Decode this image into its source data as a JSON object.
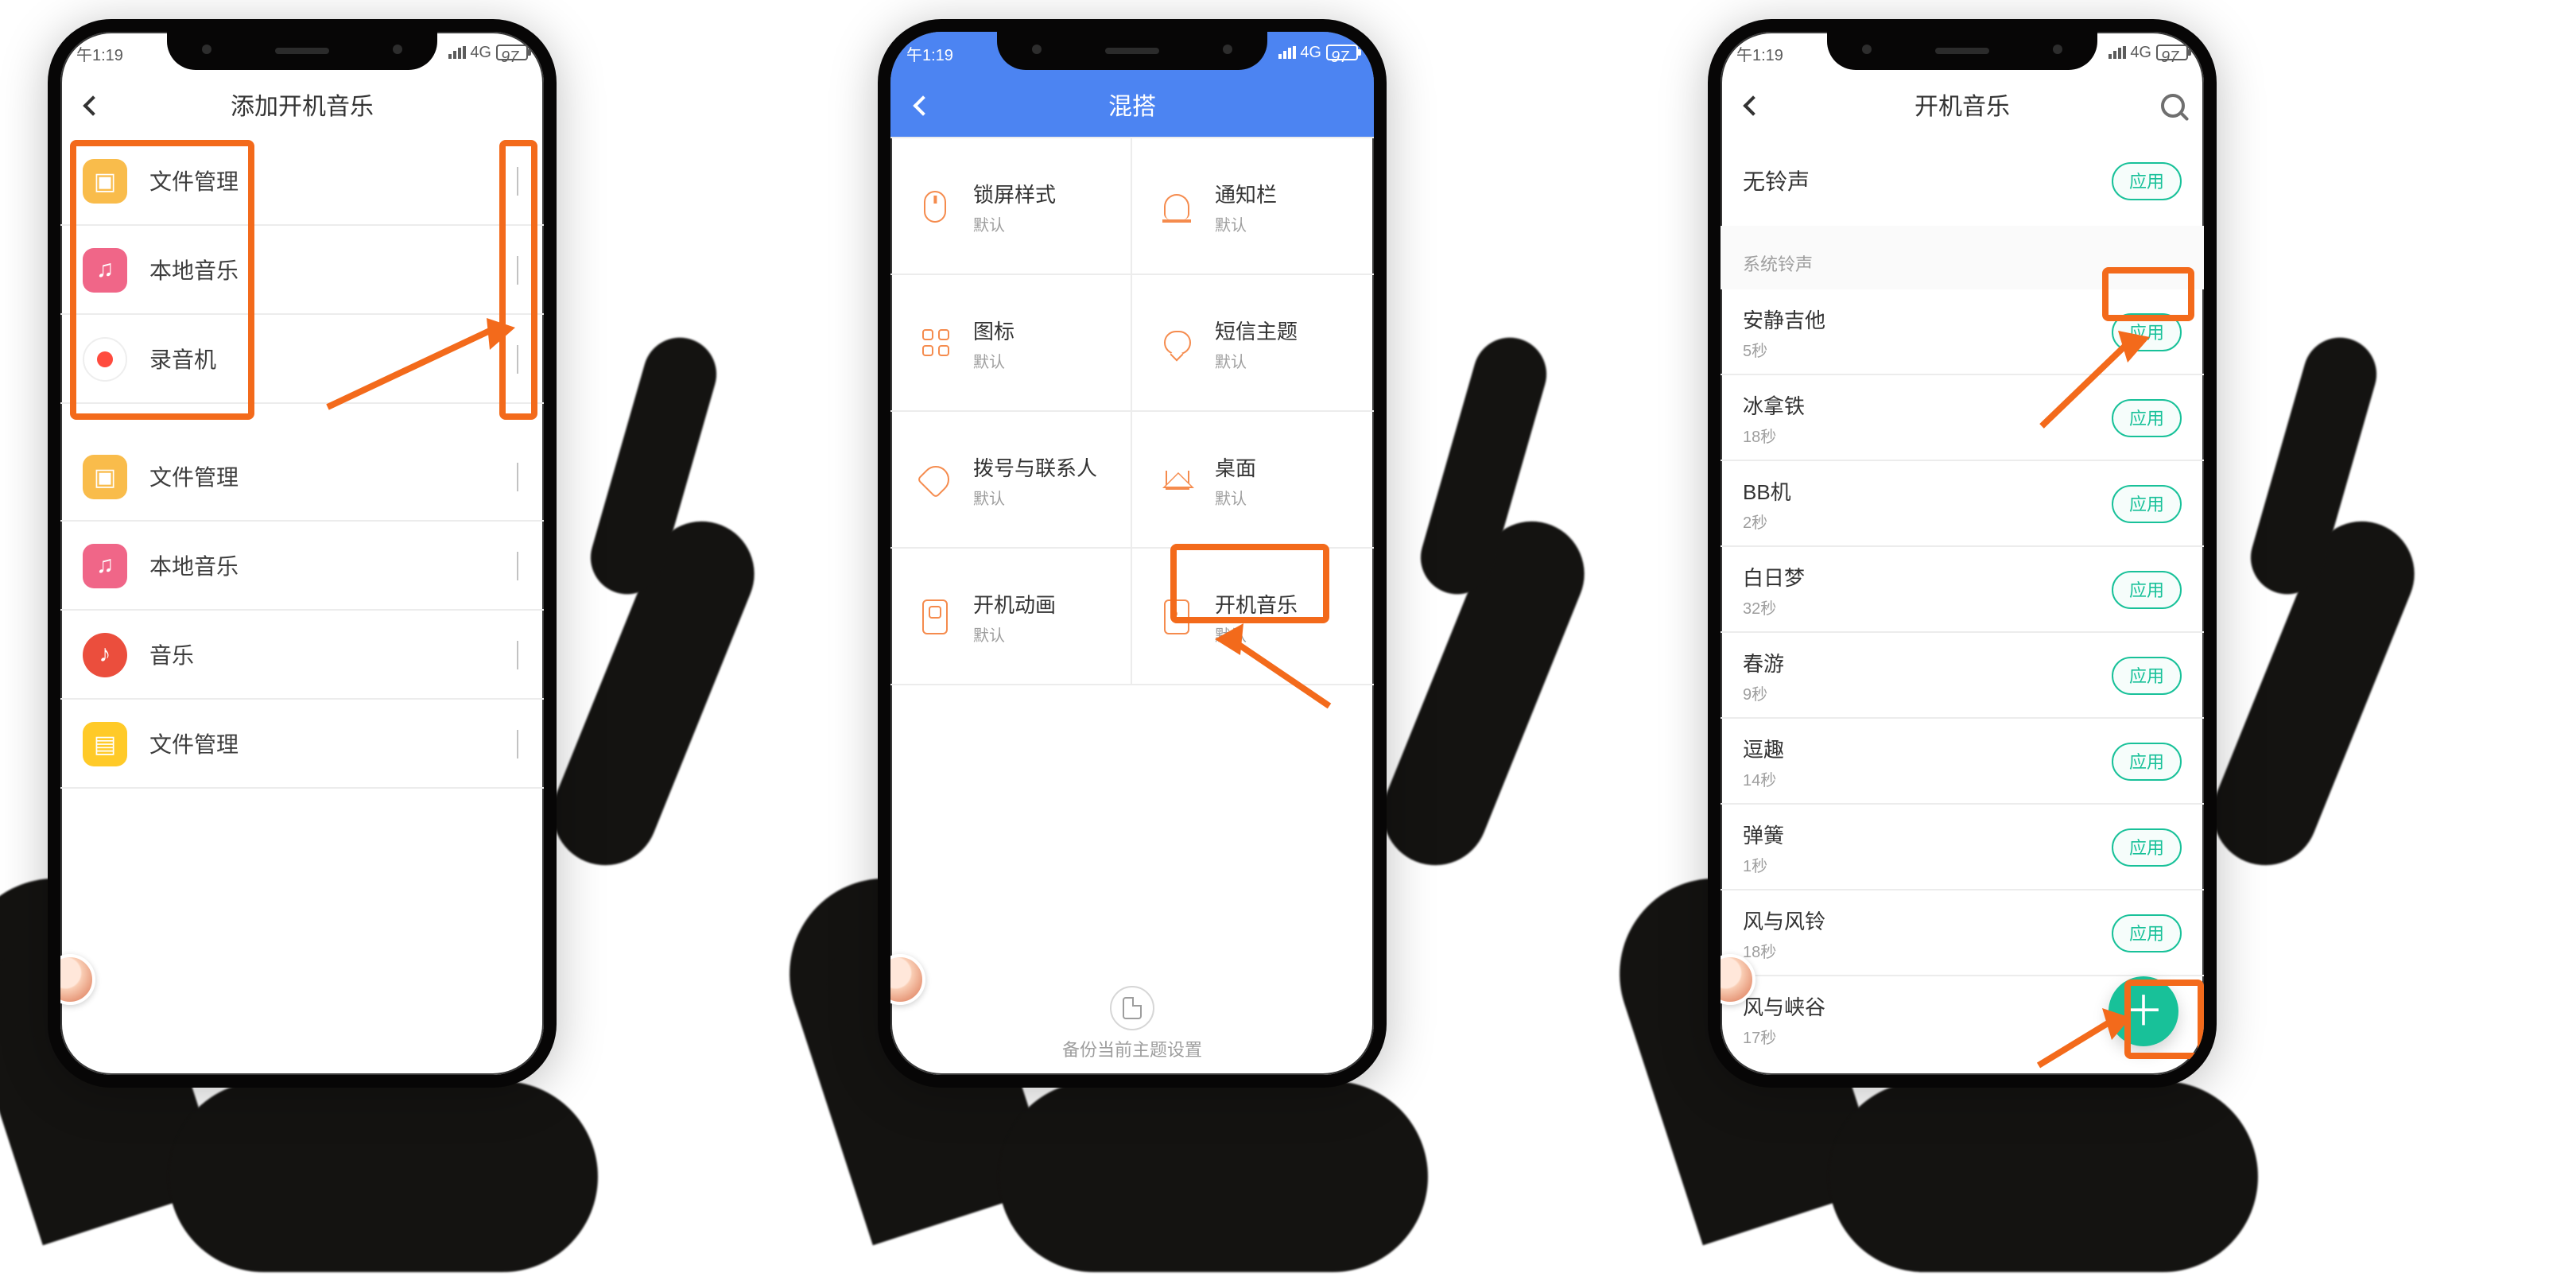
{
  "status": {
    "time": "午1:19",
    "net": "4G",
    "battery": "97"
  },
  "phone1": {
    "title": "添加开机音乐",
    "group_a": [
      {
        "icon": "folder",
        "label": "文件管理"
      },
      {
        "icon": "music",
        "label": "本地音乐"
      },
      {
        "icon": "rec",
        "label": "录音机"
      }
    ],
    "group_b": [
      {
        "icon": "folder",
        "label": "文件管理"
      },
      {
        "icon": "music",
        "label": "本地音乐"
      },
      {
        "icon": "musicO",
        "label": "音乐"
      },
      {
        "icon": "file",
        "label": "文件管理"
      }
    ]
  },
  "phone2": {
    "title": "混搭",
    "cells": [
      {
        "icon": "mouse",
        "title": "锁屏样式",
        "sub": "默认"
      },
      {
        "icon": "bell",
        "title": "通知栏",
        "sub": "默认"
      },
      {
        "icon": "grid",
        "title": "图标",
        "sub": "默认"
      },
      {
        "icon": "chat",
        "title": "短信主题",
        "sub": "默认"
      },
      {
        "icon": "phone",
        "title": "拨号与联系人",
        "sub": "默认"
      },
      {
        "icon": "home",
        "title": "桌面",
        "sub": "默认"
      },
      {
        "icon": "card",
        "title": "开机动画",
        "sub": "默认"
      },
      {
        "icon": "note",
        "title": "开机音乐",
        "sub": "默认"
      }
    ],
    "footer": "备份当前主题设置"
  },
  "phone3": {
    "title": "开机音乐",
    "no_ring": "无铃声",
    "apply": "应用",
    "section": "系统铃声",
    "sounds": [
      {
        "name": "安静吉他",
        "dur": "5秒"
      },
      {
        "name": "冰拿铁",
        "dur": "18秒"
      },
      {
        "name": "BB机",
        "dur": "2秒"
      },
      {
        "name": "白日梦",
        "dur": "32秒"
      },
      {
        "name": "春游",
        "dur": "9秒"
      },
      {
        "name": "逗趣",
        "dur": "14秒"
      },
      {
        "name": "弹簧",
        "dur": "1秒"
      },
      {
        "name": "风与风铃",
        "dur": "18秒"
      },
      {
        "name": "风与峡谷",
        "dur": "17秒"
      }
    ]
  }
}
